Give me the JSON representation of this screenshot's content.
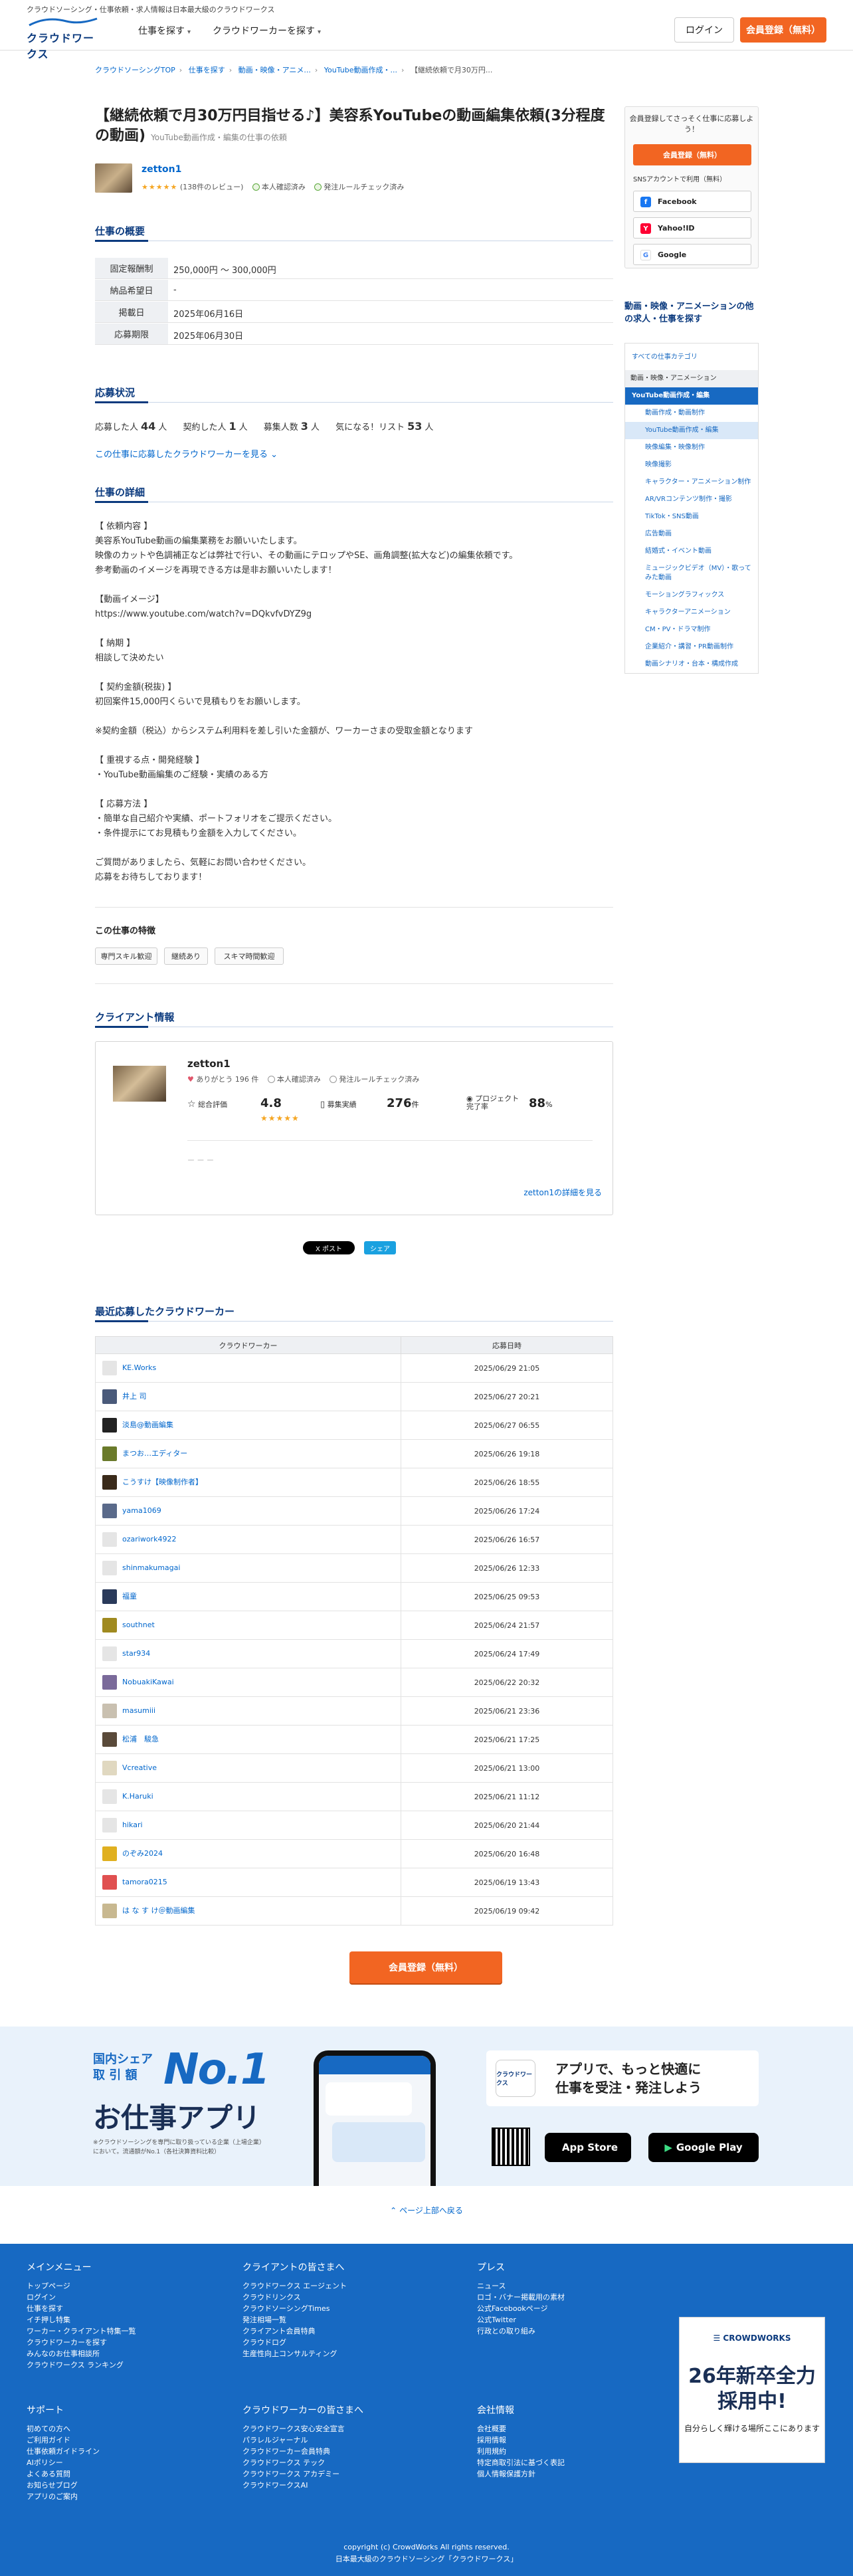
{
  "header": {
    "tagline": "クラウドソーシング・仕事依頼・求人情報は日本最大級のクラウドワークス",
    "logo_text": "クラウドワークス",
    "nav": [
      "仕事を探す",
      "クラウドワーカーを探す"
    ],
    "login": "ログイン",
    "register": "会員登録（無料）"
  },
  "breadcrumb": [
    "クラウドソーシングTOP",
    "仕事を探す",
    "動画・映像・アニメ...",
    "YouTube動画作成・...",
    "【継続依頼で月30万円..."
  ],
  "job": {
    "title": "【継続依頼で月30万円目指せる♪】美容系YouTubeの動画編集依頼(3分程度の動画)",
    "category": "YouTube動画作成・編集の仕事の依頼",
    "client_name": "zetton1",
    "rating_stars": "★★★★★",
    "reviews": "(138件のレビュー)",
    "identity": "本人確認済み",
    "order_rule": "発注ルールチェック済み"
  },
  "summary": {
    "title": "仕事の概要",
    "rows": [
      {
        "label": "固定報酬制",
        "value": "250,000円 〜 300,000円"
      },
      {
        "label": "納品希望日",
        "value": "-"
      },
      {
        "label": "掲載日",
        "value": "2025年06月16日"
      },
      {
        "label": "応募期限",
        "value": "2025年06月30日"
      }
    ]
  },
  "status": {
    "title": "応募状況",
    "applicants_label": "応募した人",
    "applicants": "44",
    "contracted_label": "契約した人",
    "contracted": "1",
    "recruit_label": "募集人数",
    "recruit": "3",
    "watch_label": "気になる！リスト",
    "watch": "53",
    "unit": "人",
    "see_link": "この仕事に応募したクラウドワーカーを見る"
  },
  "details": {
    "title": "仕事の詳細",
    "body": "【 依頼内容 】\n美容系YouTube動画の編集業務をお願いいたします。\n映像のカットや色調補正などは弊社で行い、その動画にテロップやSE、画角調整(拡大など)の編集依頼です。\n参考動画のイメージを再現できる方は是非お願いいたします！\n\n【動画イメージ】\nhttps://www.youtube.com/watch?v=DQkvfvDYZ9g\n\n【 納期 】\n相談して決めたい\n\n【 契約金額(税抜) 】\n初回案件15,000円くらいで見積もりをお願いします。\n\n※契約金額（税込）からシステム利用料を差し引いた金額が、ワーカーさまの受取金額となります\n\n【 重視する点・開発経験 】\n・YouTube動画編集のご経験・実績のある方\n\n【 応募方法 】\n・簡単な自己紹介や実績、ポートフォリオをご提示ください。\n・条件提示にてお見積もり金額を入力してください。\n\nご質問がありましたら、気軽にお問い合わせください。\n応募をお待ちしております！",
    "features_title": "この仕事の特徴",
    "features": [
      "専門スキル歓迎",
      "継続あり",
      "スキマ時間歓迎"
    ]
  },
  "client": {
    "title": "クライアント情報",
    "name": "zetton1",
    "thanks": "ありがとう 196 件",
    "identity": "本人確認済み",
    "order_rule": "発注ルールチェック済み",
    "overall_label": "総合評価",
    "overall": "4.8",
    "stars": "★★★★★",
    "orders_label": "募集実績",
    "orders": "276",
    "orders_unit": "件",
    "completion_label": "プロジェクト完了率",
    "completion": "88",
    "completion_unit": "%",
    "empty": "ー ー ー",
    "more": "zetton1の詳細を見る"
  },
  "share": {
    "x": "X ポスト",
    "fb": "シェア"
  },
  "recent": {
    "title": "最近応募したクラウドワーカー",
    "col_worker": "クラウドワーカー",
    "col_date": "応募日時",
    "rows": [
      {
        "name": "KE.Works",
        "date": "2025/06/29 21:05",
        "c": "#e5e5e5"
      },
      {
        "name": "井上 司",
        "date": "2025/06/27 20:21",
        "c": "#4a5a7a"
      },
      {
        "name": "淡島@動画編集",
        "date": "2025/06/27 06:55",
        "c": "#222"
      },
      {
        "name": "まつお…エディター",
        "date": "2025/06/26 19:18",
        "c": "#6a7a2a"
      },
      {
        "name": "こうすけ【映像制作者】",
        "date": "2025/06/26 18:55",
        "c": "#3a2a1a"
      },
      {
        "name": "yama1069",
        "date": "2025/06/26 17:24",
        "c": "#5a6a8a"
      },
      {
        "name": "ozariwork4922",
        "date": "2025/06/26 16:57",
        "c": "#e5e5e5"
      },
      {
        "name": "shinmakumagai",
        "date": "2025/06/26 12:33",
        "c": "#e5e5e5"
      },
      {
        "name": "福童",
        "date": "2025/06/25 09:53",
        "c": "#2a3a5a"
      },
      {
        "name": "southnet",
        "date": "2025/06/24 21:57",
        "c": "#a08a20"
      },
      {
        "name": "star934",
        "date": "2025/06/24 17:49",
        "c": "#e5e5e5"
      },
      {
        "name": "NobuakiKawai",
        "date": "2025/06/22 20:32",
        "c": "#7a6a9a"
      },
      {
        "name": "masumiii",
        "date": "2025/06/21 23:36",
        "c": "#c9c0b0"
      },
      {
        "name": "松浦　駿急",
        "date": "2025/06/21 17:25",
        "c": "#5a4a3a"
      },
      {
        "name": "Vcreative",
        "date": "2025/06/21 13:00",
        "c": "#e0d8c0"
      },
      {
        "name": "K.Haruki",
        "date": "2025/06/21 11:12",
        "c": "#e5e5e5"
      },
      {
        "name": "hikari",
        "date": "2025/06/20 21:44",
        "c": "#e5e5e5"
      },
      {
        "name": "のぞみ2024",
        "date": "2025/06/20 16:48",
        "c": "#e0b020"
      },
      {
        "name": "tamora0215",
        "date": "2025/06/19 13:43",
        "c": "#e05050"
      },
      {
        "name": "は な す け＠動画編集",
        "date": "2025/06/19 09:42",
        "c": "#c8b890"
      }
    ]
  },
  "cta": "会員登録（無料）",
  "banner": {
    "share_label_1": "国内シェア",
    "share_label_2": "取 引 額",
    "no1": "No.1",
    "app_name": "お仕事アプリ",
    "note": "※クラウドソーシングを専門に取り扱っている企業（上場企業）において。流通額がNo.1（各社決算資料比較）",
    "logo": "クラウドワークス",
    "tagline_1": "アプリで、もっと快適に",
    "tagline_2": "仕事を受注・発注しよう",
    "appstore": "App Store",
    "gplay": "Google Play"
  },
  "pagetop": "ページ上部へ戻る",
  "footer": {
    "col1_title": "メインメニュー",
    "col1": [
      "トップページ",
      "ログイン",
      "仕事を探す",
      "イチ押し特集",
      "ワーカー・クライアント特集一覧",
      "クラウドワーカーを探す",
      "みんなのお仕事相談所",
      "クラウドワークス ランキング"
    ],
    "col2_title": "クライアントの皆さまへ",
    "col2": [
      "クラウドワークス エージェント",
      "クラウドリンクス",
      "クラウドソーシングTimes",
      "発注相場一覧",
      "クライアント会員特典",
      "クラウドログ",
      "生産性向上コンサルティング"
    ],
    "col3_title": "プレス",
    "col3": [
      "ニュース",
      "ロゴ・バナー掲載用の素材",
      "公式Facebookページ",
      "公式Twitter",
      "行政との取り組み"
    ],
    "col4_title": "サポート",
    "col4": [
      "初めての方へ",
      "ご利用ガイド",
      "仕事依頼ガイドライン",
      "AIポリシー",
      "よくある質問",
      "お知らせブログ",
      "アプリのご案内"
    ],
    "col5_title": "クラウドワーカーの皆さまへ",
    "col5": [
      "クラウドワークス安心安全宣言",
      "パラレルジャーナル",
      "クラウドワーカー会員特典",
      "クラウドワークス テック",
      "クラウドワークス アカデミー",
      "クラウドワークスAI"
    ],
    "col6_title": "会社情報",
    "col6": [
      "会社概要",
      "採用情報",
      "利用規約",
      "特定商取引法に基づく表記",
      "個人情報保護方針"
    ],
    "fb_brand": "CROWDWORKS",
    "fb_title": "26年新卒全力採用中!",
    "fb_sub": "自分らしく輝ける場所ここにあります",
    "copyright": "copyright (c) CrowdWorks All rights reserved.",
    "copyright2": "日本最大級のクラウドソーシング「クラウドワークス」"
  },
  "sidebar": {
    "msg": "会員登録してさっそく仕事に応募しよう！",
    "register": "会員登録（無料）",
    "sns_label": "SNSアカウントで利用（無料）",
    "sns": [
      "Facebook",
      "Yahoo!ID",
      "Google"
    ],
    "cat_title": "動画・映像・アニメーションの他の求人・仕事を探す",
    "cat_all": "すべての仕事カテゴリ",
    "cat_head": "動画・映像・アニメーション",
    "cat_sub": "YouTube動画作成・編集",
    "cat_items": [
      "動画作成・動画制作",
      "YouTube動画作成・編集",
      "映像編集・映像制作",
      "映像撮影",
      "キャラクター・アニメーション制作",
      "AR/VRコンテンツ制作・撮影",
      "TikTok・SNS動画",
      "広告動画",
      "結婚式・イベント動画",
      "ミュージックビデオ（MV）・歌ってみた動画",
      "モーショングラフィックス",
      "キャラクターアニメーション",
      "CM・PV・ドラマ制作",
      "企業紹介・講習・PR動画制作",
      "動画シナリオ・台本・構成作成"
    ]
  },
  "colors": {
    "brand": "#0b3a7e",
    "accent": "#f26522",
    "link": "#0066cc",
    "footer": "#1769c2"
  }
}
